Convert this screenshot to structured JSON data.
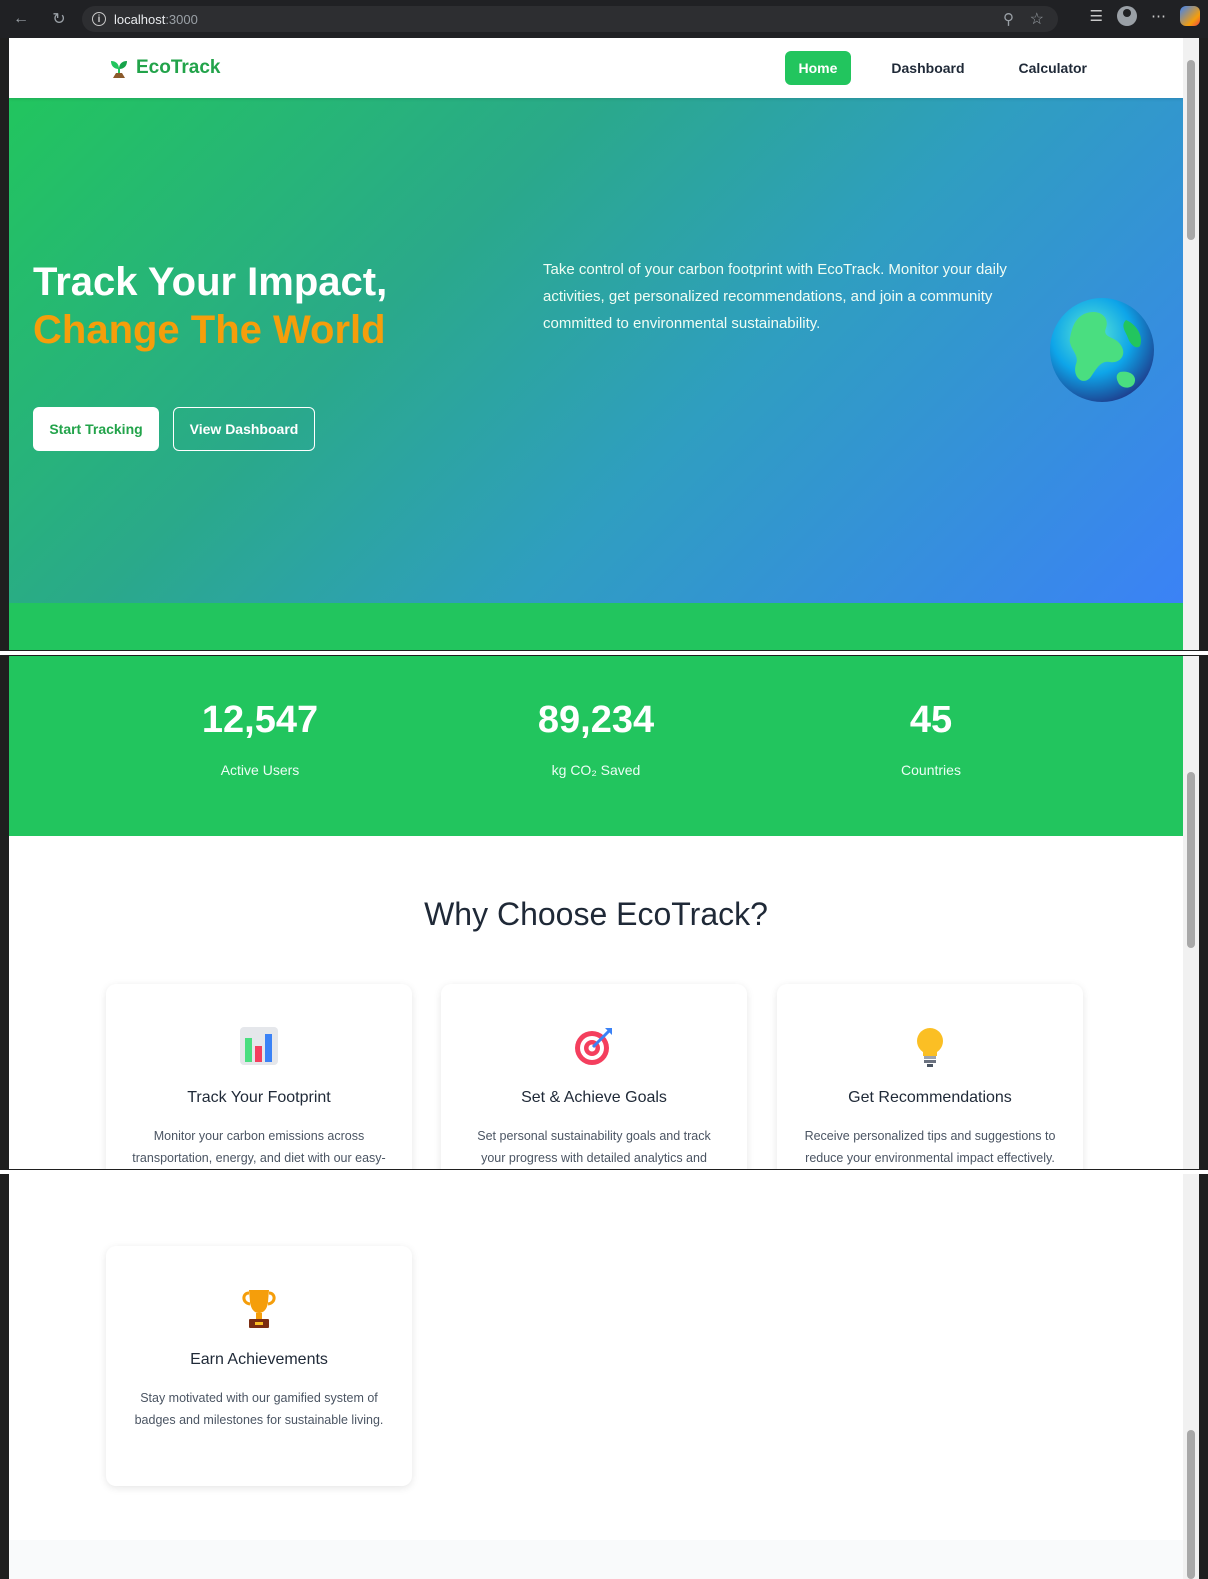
{
  "browser": {
    "url_host": "localhost",
    "url_port": ":3000"
  },
  "site": {
    "logo_text": "EcoTrack",
    "nav": [
      {
        "label": "Home",
        "active": true
      },
      {
        "label": "Dashboard",
        "active": false
      },
      {
        "label": "Calculator",
        "active": false
      }
    ]
  },
  "hero": {
    "title_line1": "Track Your Impact,",
    "title_line2": "Change The World",
    "description": "Take control of your carbon footprint with EcoTrack. Monitor your daily activities, get personalized recommendations, and join a community committed to environmental sustainability.",
    "primary_button": "Start Tracking",
    "secondary_button": "View Dashboard",
    "illustration": "globe-icon"
  },
  "stats": [
    {
      "value": "12,547",
      "label": "Active Users"
    },
    {
      "value": "89,234",
      "label": "kg CO₂ Saved"
    },
    {
      "value": "45",
      "label": "Countries"
    }
  ],
  "features": {
    "title": "Why Choose EcoTrack?",
    "cards": [
      {
        "icon": "bar-chart-icon",
        "title": "Track Your Footprint",
        "text": "Monitor your carbon emissions across transportation, energy, and diet with our easy-to-use calculator."
      },
      {
        "icon": "target-icon",
        "title": "Set & Achieve Goals",
        "text": "Set personal sustainability goals and track your progress with detailed analytics and insights."
      },
      {
        "icon": "lightbulb-icon",
        "title": "Get Recommendations",
        "text": "Receive personalized tips and suggestions to reduce your environmental impact effectively."
      },
      {
        "icon": "trophy-icon",
        "title": "Earn Achievements",
        "text": "Stay motivated with our gamified system of badges and milestones for sustainable living."
      }
    ]
  },
  "colors": {
    "brand_green": "#22c55e",
    "accent_orange": "#f59e0b",
    "gradient_end_blue": "#3b82f6"
  }
}
